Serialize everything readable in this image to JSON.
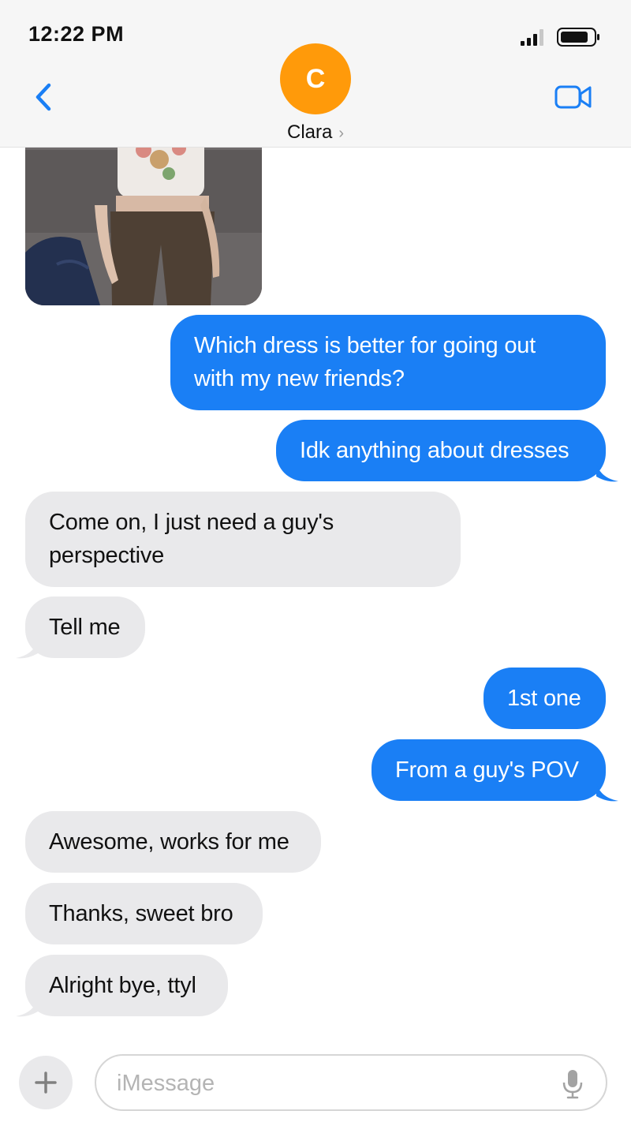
{
  "status_bar": {
    "time": "12:22 PM"
  },
  "header": {
    "avatar_initial": "C",
    "contact_name": "Clara",
    "contact_chevron": "›",
    "back_icon": "chevron-left-icon",
    "video_icon": "video-camera-icon"
  },
  "colors": {
    "sent_bubble": "#1a7ff5",
    "received_bubble": "#e9e9eb",
    "accent": "#1a7ff5",
    "avatar": "#ff9a0a"
  },
  "messages": [
    {
      "from": "contact",
      "type": "image"
    },
    {
      "from": "me",
      "text": "Which dress is better for going out\nwith my new friends?"
    },
    {
      "from": "me",
      "text": "Idk anything about dresses"
    },
    {
      "from": "contact",
      "text": "Come on, I just need a guy's\nperspective"
    },
    {
      "from": "contact",
      "text": "Tell me"
    },
    {
      "from": "me",
      "text": "1st one"
    },
    {
      "from": "me",
      "text": "From a guy's POV"
    },
    {
      "from": "contact",
      "text": "Awesome, works for me"
    },
    {
      "from": "contact",
      "text": "Thanks, sweet bro"
    },
    {
      "from": "contact",
      "text": "Alright bye, ttyl"
    }
  ],
  "input_bar": {
    "placeholder": "iMessage",
    "plus_icon": "plus-icon",
    "mic_icon": "microphone-icon"
  }
}
